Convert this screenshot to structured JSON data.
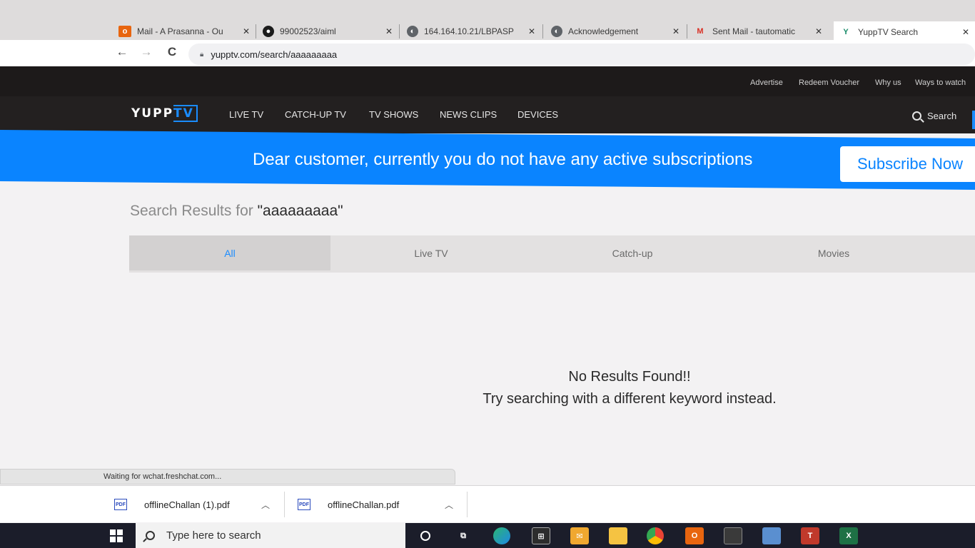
{
  "browser": {
    "tabs": [
      {
        "label": "Mail - A Prasanna - Ou",
        "icon": "outlook-icon",
        "close": "✕"
      },
      {
        "label": "99002523/aiml",
        "icon": "github-icon",
        "close": "✕"
      },
      {
        "label": "164.164.10.21/LBPASP",
        "icon": "globe-icon",
        "close": "✕"
      },
      {
        "label": "Acknowledgement",
        "icon": "globe-icon",
        "close": "✕"
      },
      {
        "label": "Sent Mail - tautomatic",
        "icon": "gmail-icon",
        "close": "✕"
      },
      {
        "label": "YuppTV Search",
        "icon": "yupptv-icon",
        "close": "✕"
      }
    ],
    "address": "yupptv.com/search/aaaaaaaaa",
    "back": "←",
    "forward": "→",
    "reload": "C"
  },
  "site": {
    "util_links": [
      "Advertise",
      "Redeem Voucher",
      "Why us",
      "Ways to watch"
    ],
    "logo_main": "YUPP",
    "logo_tv": "TV",
    "nav": [
      "LIVE TV",
      "CATCH-UP TV",
      "TV SHOWS",
      "NEWS CLIPS",
      "DEVICES"
    ],
    "search_label": "Search",
    "banner_text": "Dear customer, currently you do not have any active subscriptions",
    "subscribe_label": "Subscribe Now",
    "results_prefix": "Search Results for",
    "results_query": "\"aaaaaaaaa\"",
    "filters": [
      "All",
      "Live TV",
      "Catch-up",
      "Movies"
    ],
    "no_results_line1": "No Results Found!!",
    "no_results_line2": "Try searching with a different keyword instead."
  },
  "status_text": "Waiting for wchat.freshchat.com...",
  "downloads": [
    {
      "name": "offlineChallan (1).pdf",
      "icon_text": "PDF"
    },
    {
      "name": "offlineChallan.pdf",
      "icon_text": "PDF"
    }
  ],
  "taskbar": {
    "search_placeholder": "Type here to search"
  },
  "colors": {
    "brand_blue": "#0a84ff",
    "nav_dark": "#232020",
    "taskbar": "#1b1d2a"
  }
}
